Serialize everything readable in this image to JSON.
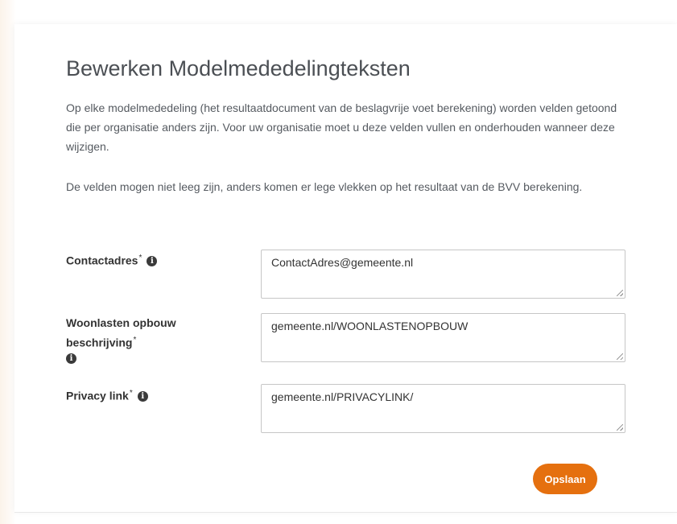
{
  "page": {
    "title": "Bewerken Modelmededelingteksten",
    "intro_paragraph": "Op elke modelmededeling (het resultaatdocument van de beslagvrije voet berekening) worden velden getoond die per organisatie anders zijn. Voor uw organisatie moet u deze velden vullen en onderhouden wanneer deze wijzigen.",
    "warning_paragraph": "De velden mogen niet leeg zijn, anders komen er lege vlekken op het resultaat van de BVV berekening."
  },
  "form": {
    "required_marker": "*",
    "info_icon_glyph": "i",
    "fields": [
      {
        "label": "Contactadres",
        "value": "ContactAdres@gemeente.nl",
        "icon": "info-icon"
      },
      {
        "label": "Woonlasten opbouw beschrijving",
        "value": "gemeente.nl/WOONLASTENOPBOUW",
        "icon": "info-icon"
      },
      {
        "label": "Privacy link",
        "value": "gemeente.nl/PRIVACYLINK/",
        "icon": "info-icon"
      }
    ],
    "save_label": "Opslaan"
  },
  "colors": {
    "accent": "#e5700f",
    "title_text": "#4b4f54",
    "body_text": "#555a60",
    "field_border": "#c6c6c6",
    "info_icon_bg": "#3a3a3a"
  }
}
